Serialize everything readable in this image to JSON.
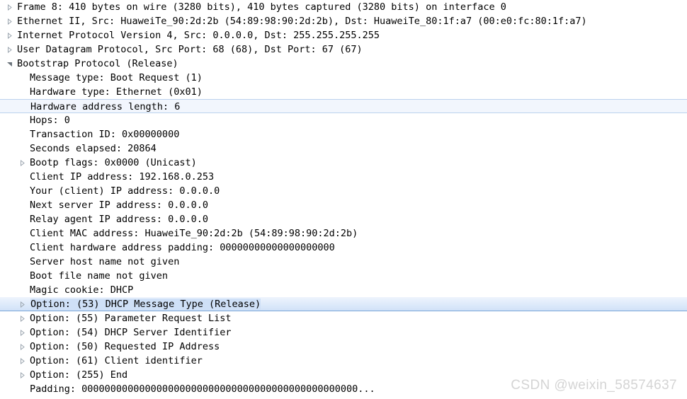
{
  "pane": {
    "name": "Wireshark packet details"
  },
  "rows": [
    {
      "level": 0,
      "twisty": "collapsed",
      "selected": "none",
      "text": "Frame 8: 410 bytes on wire (3280 bits), 410 bytes captured (3280 bits) on interface 0"
    },
    {
      "level": 0,
      "twisty": "collapsed",
      "selected": "none",
      "text": "Ethernet II, Src: HuaweiTe_90:2d:2b (54:89:98:90:2d:2b), Dst: HuaweiTe_80:1f:a7 (00:e0:fc:80:1f:a7)"
    },
    {
      "level": 0,
      "twisty": "collapsed",
      "selected": "none",
      "text": "Internet Protocol Version 4, Src: 0.0.0.0, Dst: 255.255.255.255"
    },
    {
      "level": 0,
      "twisty": "collapsed",
      "selected": "none",
      "text": "User Datagram Protocol, Src Port: 68 (68), Dst Port: 67 (67)"
    },
    {
      "level": 0,
      "twisty": "expanded",
      "selected": "none",
      "text": "Bootstrap Protocol (Release)"
    },
    {
      "level": 1,
      "twisty": "none",
      "selected": "none",
      "text": "Message type: Boot Request (1)"
    },
    {
      "level": 1,
      "twisty": "none",
      "selected": "none",
      "text": "Hardware type: Ethernet (0x01)"
    },
    {
      "level": 1,
      "twisty": "none",
      "selected": "light",
      "text": "Hardware address length: 6"
    },
    {
      "level": 1,
      "twisty": "none",
      "selected": "none",
      "text": "Hops: 0"
    },
    {
      "level": 1,
      "twisty": "none",
      "selected": "none",
      "text": "Transaction ID: 0x00000000"
    },
    {
      "level": 1,
      "twisty": "none",
      "selected": "none",
      "text": "Seconds elapsed: 20864"
    },
    {
      "level": 1,
      "twisty": "collapsed",
      "selected": "none",
      "text": "Bootp flags: 0x0000 (Unicast)"
    },
    {
      "level": 1,
      "twisty": "none",
      "selected": "none",
      "text": "Client IP address: 192.168.0.253"
    },
    {
      "level": 1,
      "twisty": "none",
      "selected": "none",
      "text": "Your (client) IP address: 0.0.0.0"
    },
    {
      "level": 1,
      "twisty": "none",
      "selected": "none",
      "text": "Next server IP address: 0.0.0.0"
    },
    {
      "level": 1,
      "twisty": "none",
      "selected": "none",
      "text": "Relay agent IP address: 0.0.0.0"
    },
    {
      "level": 1,
      "twisty": "none",
      "selected": "none",
      "text": "Client MAC address: HuaweiTe_90:2d:2b (54:89:98:90:2d:2b)"
    },
    {
      "level": 1,
      "twisty": "none",
      "selected": "none",
      "text": "Client hardware address padding: 00000000000000000000"
    },
    {
      "level": 1,
      "twisty": "none",
      "selected": "none",
      "text": "Server host name not given"
    },
    {
      "level": 1,
      "twisty": "none",
      "selected": "none",
      "text": "Boot file name not given"
    },
    {
      "level": 1,
      "twisty": "none",
      "selected": "none",
      "text": "Magic cookie: DHCP"
    },
    {
      "level": 1,
      "twisty": "collapsed",
      "selected": "strong",
      "text": "Option: (53) DHCP Message Type (Release)"
    },
    {
      "level": 1,
      "twisty": "collapsed",
      "selected": "none",
      "text": "Option: (55) Parameter Request List"
    },
    {
      "level": 1,
      "twisty": "collapsed",
      "selected": "none",
      "text": "Option: (54) DHCP Server Identifier"
    },
    {
      "level": 1,
      "twisty": "collapsed",
      "selected": "none",
      "text": "Option: (50) Requested IP Address"
    },
    {
      "level": 1,
      "twisty": "collapsed",
      "selected": "none",
      "text": "Option: (61) Client identifier"
    },
    {
      "level": 1,
      "twisty": "collapsed",
      "selected": "none",
      "text": "Option: (255) End"
    },
    {
      "level": 1,
      "twisty": "none",
      "selected": "none",
      "text": "Padding: 000000000000000000000000000000000000000000000000..."
    }
  ],
  "watermark": {
    "text": "CSDN @weixin_58574637",
    "color": "#d4d4d4"
  },
  "colors": {
    "background": "#ffffff",
    "text": "#000000",
    "twisty": "#9aa4ae",
    "selection_light_fill": "#f2f6fd",
    "selection_light_border": "#bcd2ee",
    "selection_strong_fill": "#d3e3f8",
    "selection_strong_border": "#7aa7d8"
  }
}
